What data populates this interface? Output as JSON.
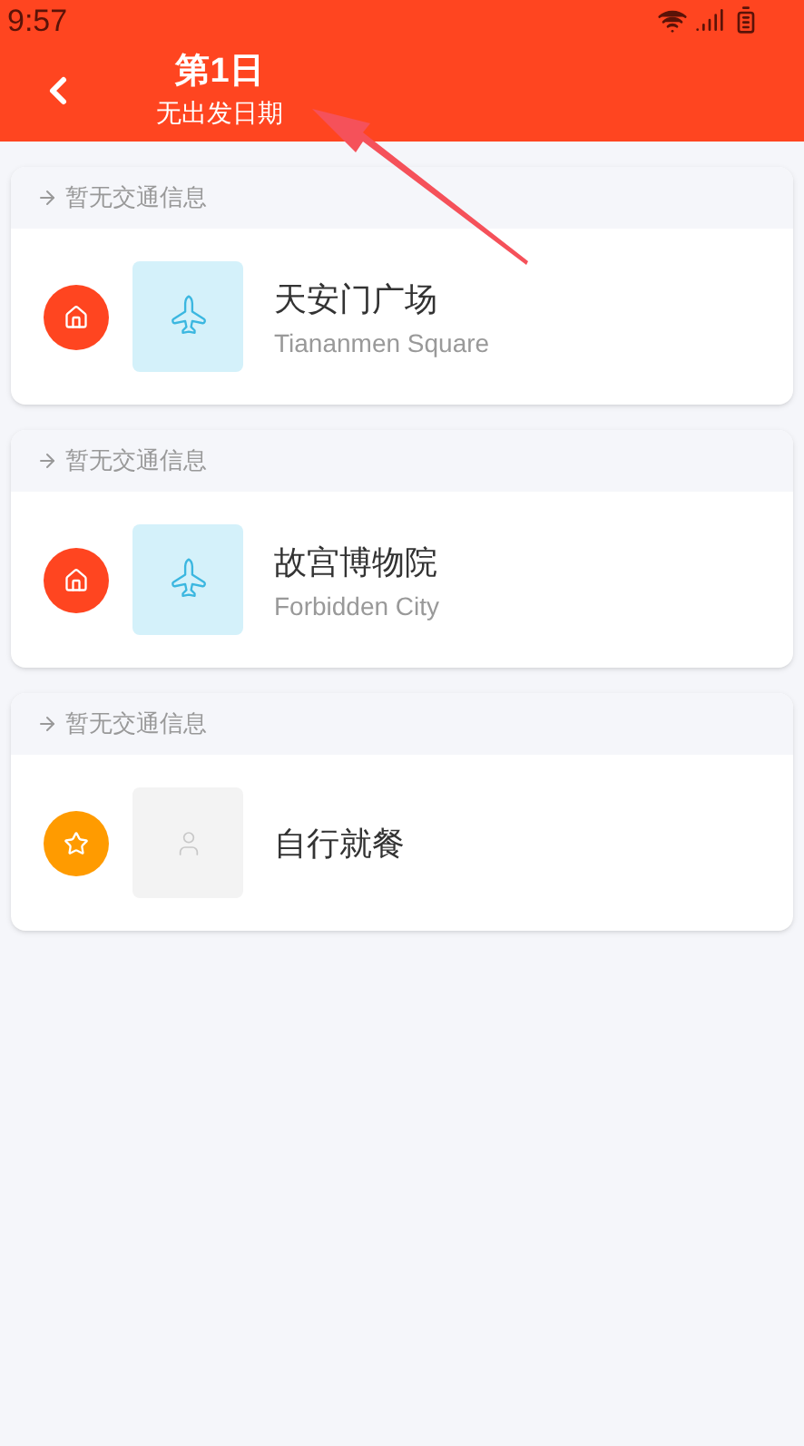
{
  "status_bar": {
    "time": "9:57"
  },
  "header": {
    "title": "第1日",
    "subtitle": "无出发日期"
  },
  "stops": [
    {
      "transport": "暂无交通信息",
      "kind": "attraction",
      "name": "天安门广场",
      "name_en": "Tiananmen Square"
    },
    {
      "transport": "暂无交通信息",
      "kind": "attraction",
      "name": "故宫博物院",
      "name_en": "Forbidden City"
    },
    {
      "transport": "暂无交通信息",
      "kind": "meal",
      "name": "自行就餐"
    }
  ]
}
